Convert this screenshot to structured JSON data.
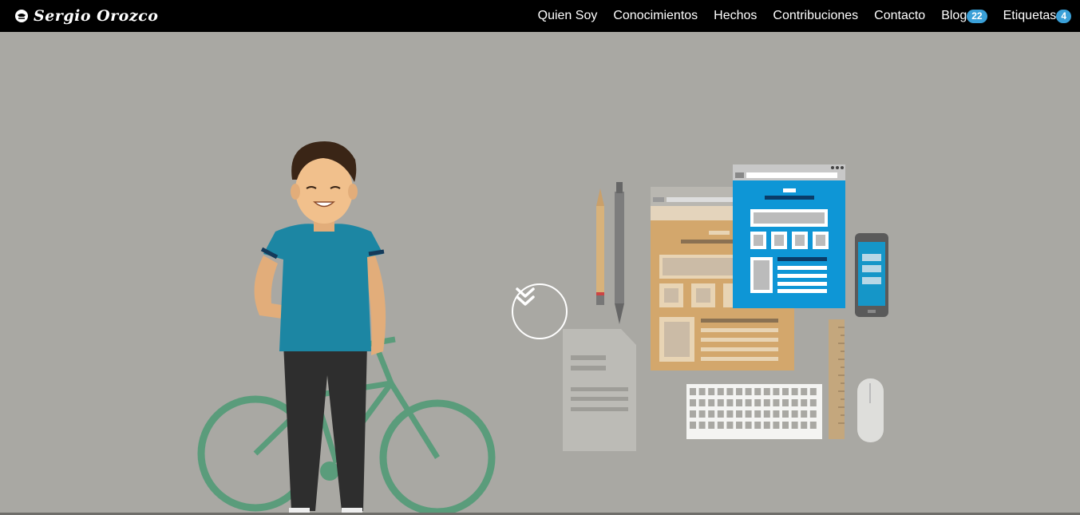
{
  "navbar": {
    "brand": "Sergio Orozco",
    "items": [
      {
        "label": "Quien Soy"
      },
      {
        "label": "Conocimientos"
      },
      {
        "label": "Hechos"
      },
      {
        "label": "Contribuciones"
      },
      {
        "label": "Contacto"
      },
      {
        "label": "Blog",
        "badge": "22"
      },
      {
        "label": "Etiquetas",
        "badge": "4"
      }
    ]
  },
  "hero": {
    "background_color": "#a9a8a3",
    "scroll_icon": "chevron-double-down-icon"
  },
  "colors": {
    "navbar": "#000000",
    "badge": "#3aa0d8",
    "shirt": "#1c86a3",
    "bike": "#5a9c7b",
    "browser_blue": "#0e96d6",
    "paper_tan": "#d3a76c"
  }
}
